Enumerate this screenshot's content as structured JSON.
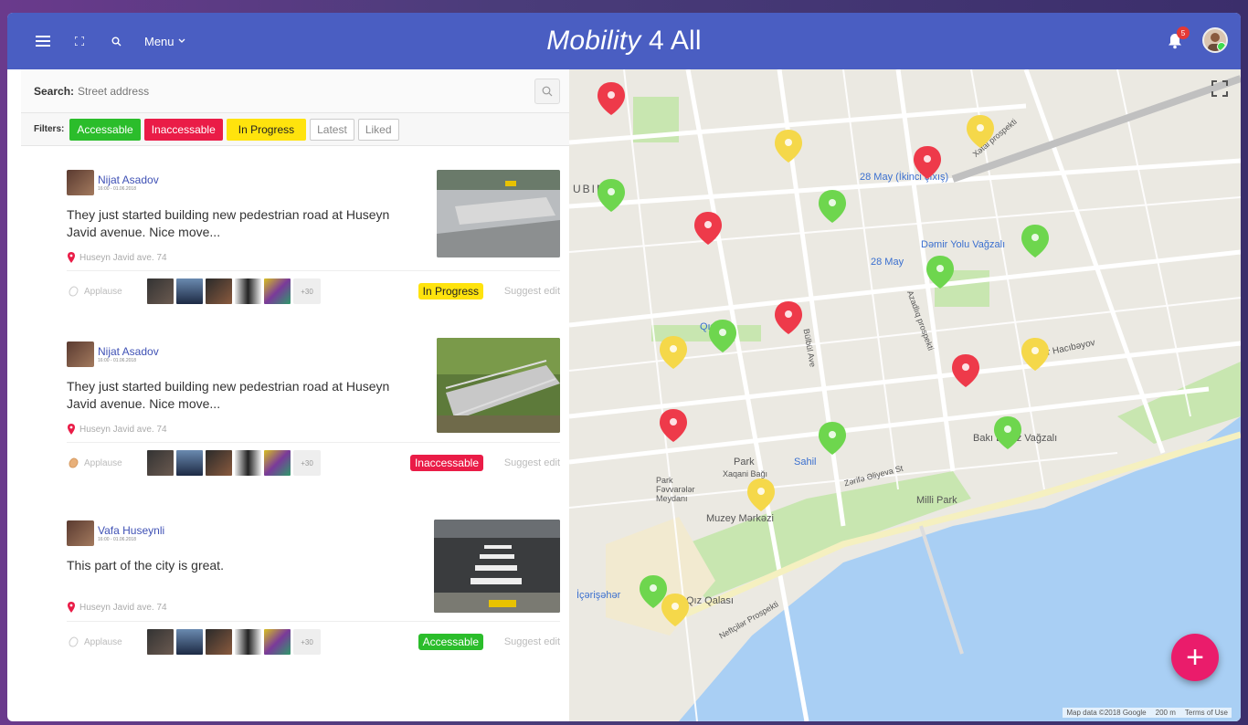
{
  "app": {
    "title_italic": "Mobility",
    "title_rest": " 4 All",
    "menu_label": "Menu",
    "notification_count": "5"
  },
  "search": {
    "label": "Search:",
    "placeholder": "Street address"
  },
  "filters": {
    "label": "Filters:",
    "items": [
      "Accessable",
      "Inaccessable",
      "In Progress",
      "Latest",
      "Liked"
    ]
  },
  "posts": [
    {
      "author": "Nijat Asadov",
      "time": "16:00 - 01.06.2018",
      "text": "They just started building new pedestrian road at Huseyn Javid avenue. Nice move...",
      "location": "Huseyn Javid ave. 74",
      "applause": "Applause",
      "more": "+30",
      "status": "In Progress",
      "suggest": "Suggest edit"
    },
    {
      "author": "Nijat Asadov",
      "time": "16:00 - 01.06.2018",
      "text": "They just started building new pedestrian road at Huseyn Javid avenue. Nice move...",
      "location": "Huseyn Javid ave. 74",
      "applause": "Applause",
      "more": "+30",
      "status": "Inaccessable",
      "suggest": "Suggest edit"
    },
    {
      "author": "Vafa Huseynli",
      "time": "16:00 - 01.06.2018",
      "text": "This part of the city is great.",
      "location": "Huseyn Javid ave. 74",
      "applause": "Applause",
      "more": "+30",
      "status": "Accessable",
      "suggest": "Suggest edit"
    }
  ],
  "map": {
    "labels": [
      "28 May (İkinci çıxış)",
      "Dəmir Yolu Vağzalı",
      "28 May",
      "Park",
      "Xaqani Bağı",
      "Park Fəvvarələr Meydanı",
      "Muzey Mərkəzi",
      "Sahil",
      "Milli Park",
      "Qız Qalası",
      "İçərişəhər",
      "Bakı Dəniz Vağzalı",
      "Üzeyir Hacıbəyov",
      "Neftçilər Prospekti",
      "Zərifə Əliyeva St",
      "Bülbül Ave",
      "Azadlıq prospekti",
      "Xətai prospekti",
      "UBINA",
      "Qış"
    ],
    "footer": [
      "Map data ©2018 Google",
      "200 m",
      "Terms of Use"
    ]
  },
  "colors": {
    "header": "#4a5ec2",
    "accessable": "#2bbd2b",
    "inaccessable": "#ea1c47",
    "in_progress": "#ffe30d",
    "fab": "#ea1c6b"
  }
}
